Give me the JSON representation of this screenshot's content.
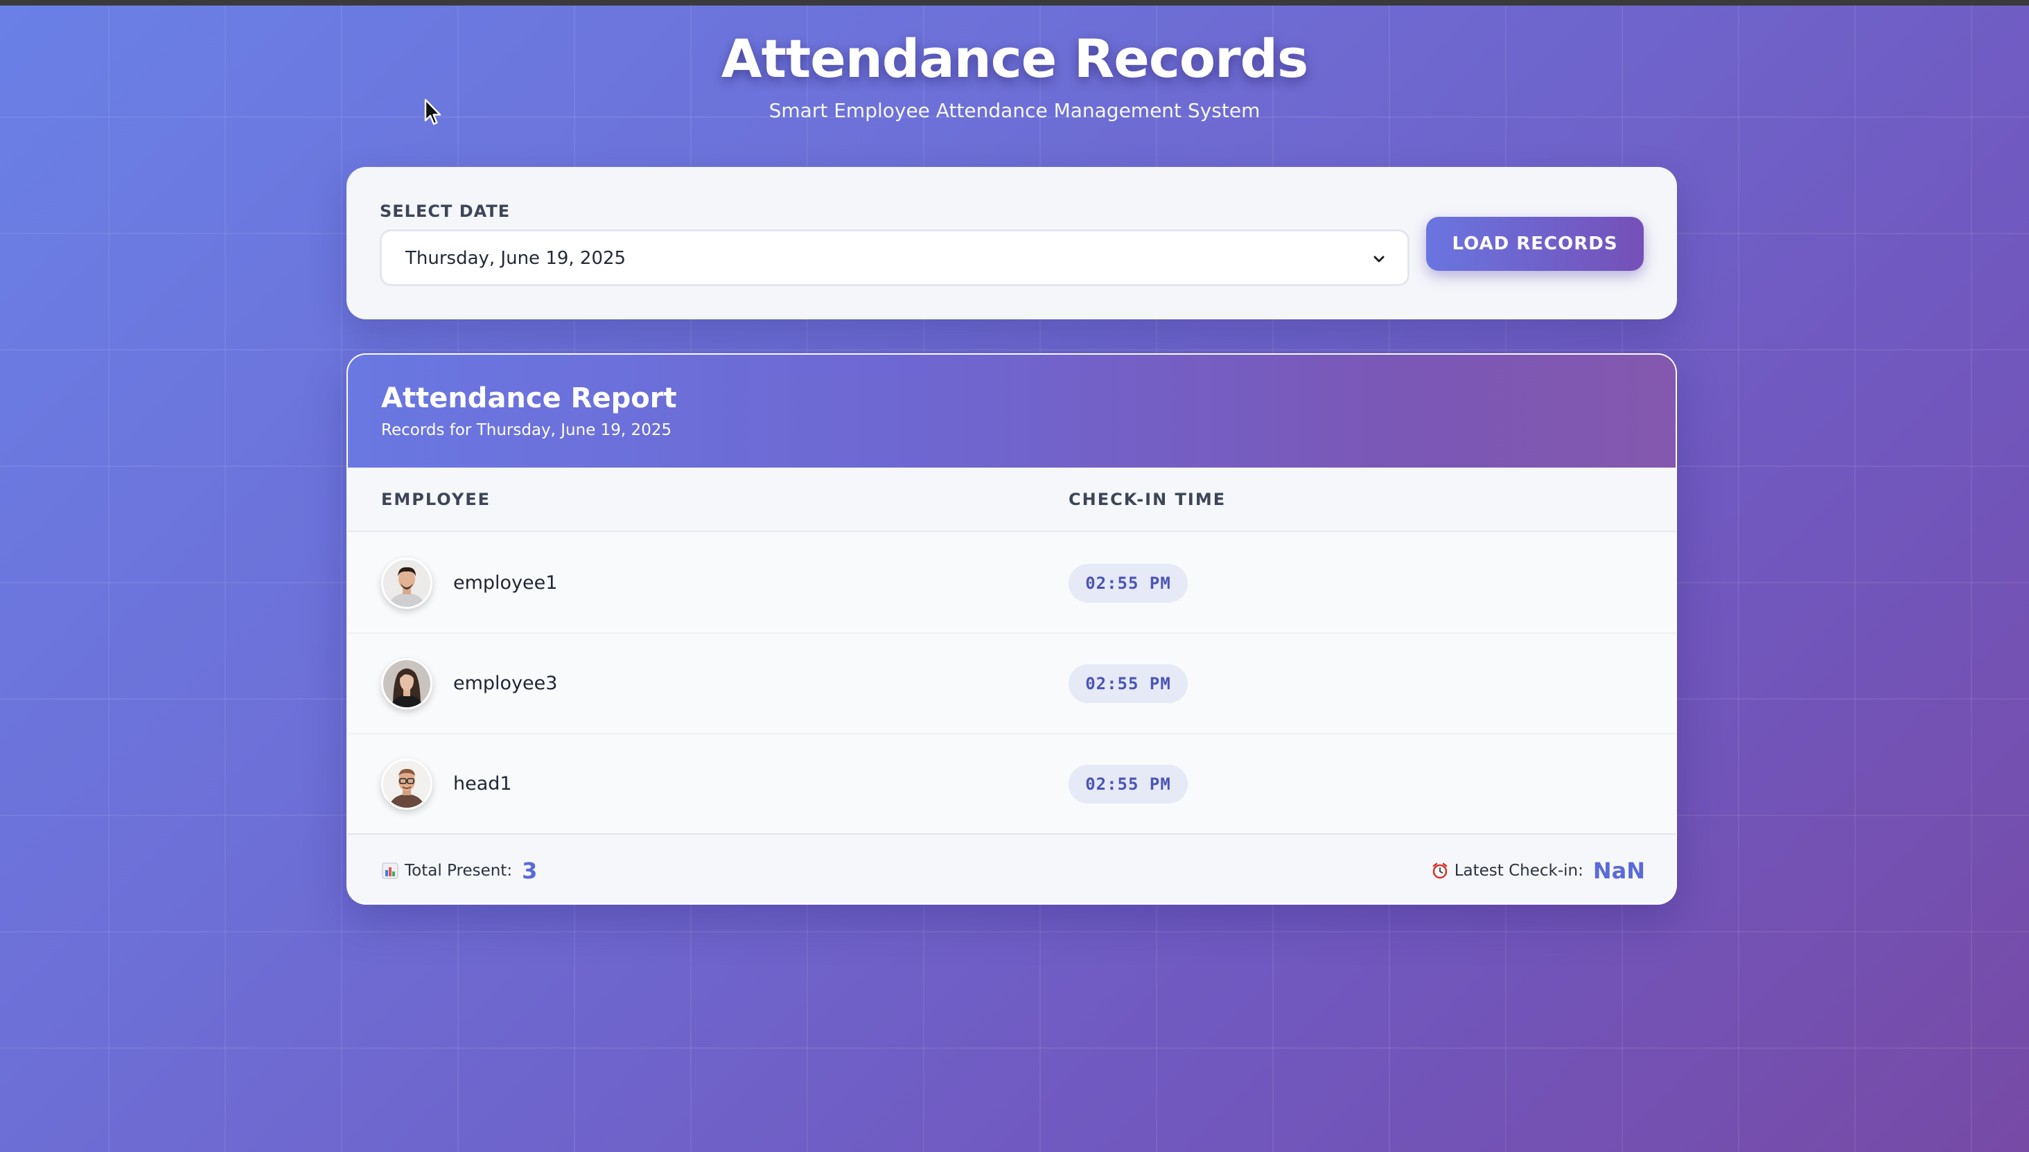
{
  "header": {
    "title": "Attendance Records",
    "subtitle": "Smart Employee Attendance Management System"
  },
  "date_picker": {
    "label": "SELECT DATE",
    "selected_value": "Thursday, June 19, 2025",
    "load_button_label": "LOAD RECORDS"
  },
  "report": {
    "title": "Attendance Report",
    "subtitle": "Records for Thursday, June 19, 2025",
    "columns": [
      "EMPLOYEE",
      "CHECK-IN TIME"
    ],
    "rows": [
      {
        "name": "employee1",
        "check_in": "02:55 PM",
        "avatar": "male-avatar"
      },
      {
        "name": "employee3",
        "check_in": "02:55 PM",
        "avatar": "female-avatar"
      },
      {
        "name": "head1",
        "check_in": "02:55 PM",
        "avatar": "male-glasses-avatar"
      }
    ],
    "footer": {
      "total_present_label": "Total Present:",
      "total_present_value": "3",
      "latest_checkin_label": "Latest Check-in:",
      "latest_checkin_value": "NaN"
    }
  },
  "colors": {
    "accent": "#5a6ad8",
    "gradient_start": "#6a80e6",
    "gradient_end": "#774aa6"
  }
}
